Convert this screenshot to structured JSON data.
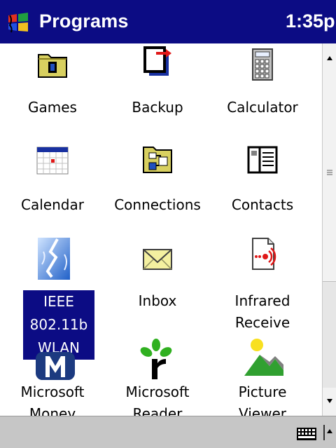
{
  "titlebar": {
    "title": "Programs",
    "clock": "1:35p"
  },
  "programs": [
    {
      "label": "Games",
      "icon": "games-folder-icon"
    },
    {
      "label": "Backup",
      "icon": "backup-icon"
    },
    {
      "label": "Calculator",
      "icon": "calculator-icon"
    },
    {
      "label": "Calendar",
      "icon": "calendar-icon"
    },
    {
      "label": "Connections",
      "icon": "connections-folder-icon"
    },
    {
      "label": "Contacts",
      "icon": "contacts-icon"
    },
    {
      "label": "IEEE\n802.11b\nWLAN",
      "icon": "wlan-icon",
      "selected": true
    },
    {
      "label": "Inbox",
      "icon": "inbox-envelope-icon"
    },
    {
      "label": "Infrared\nReceive",
      "icon": "infrared-receive-icon"
    },
    {
      "label": "Microsoft\nMoney",
      "icon": "microsoft-money-icon"
    },
    {
      "label": "Microsoft\nReader",
      "icon": "microsoft-reader-icon"
    },
    {
      "label": "Picture\nViewer",
      "icon": "picture-viewer-icon"
    }
  ],
  "colors": {
    "titlebar": "#0c0c84",
    "selection": "#0c0c84",
    "menubar": "#c6c6c6"
  }
}
